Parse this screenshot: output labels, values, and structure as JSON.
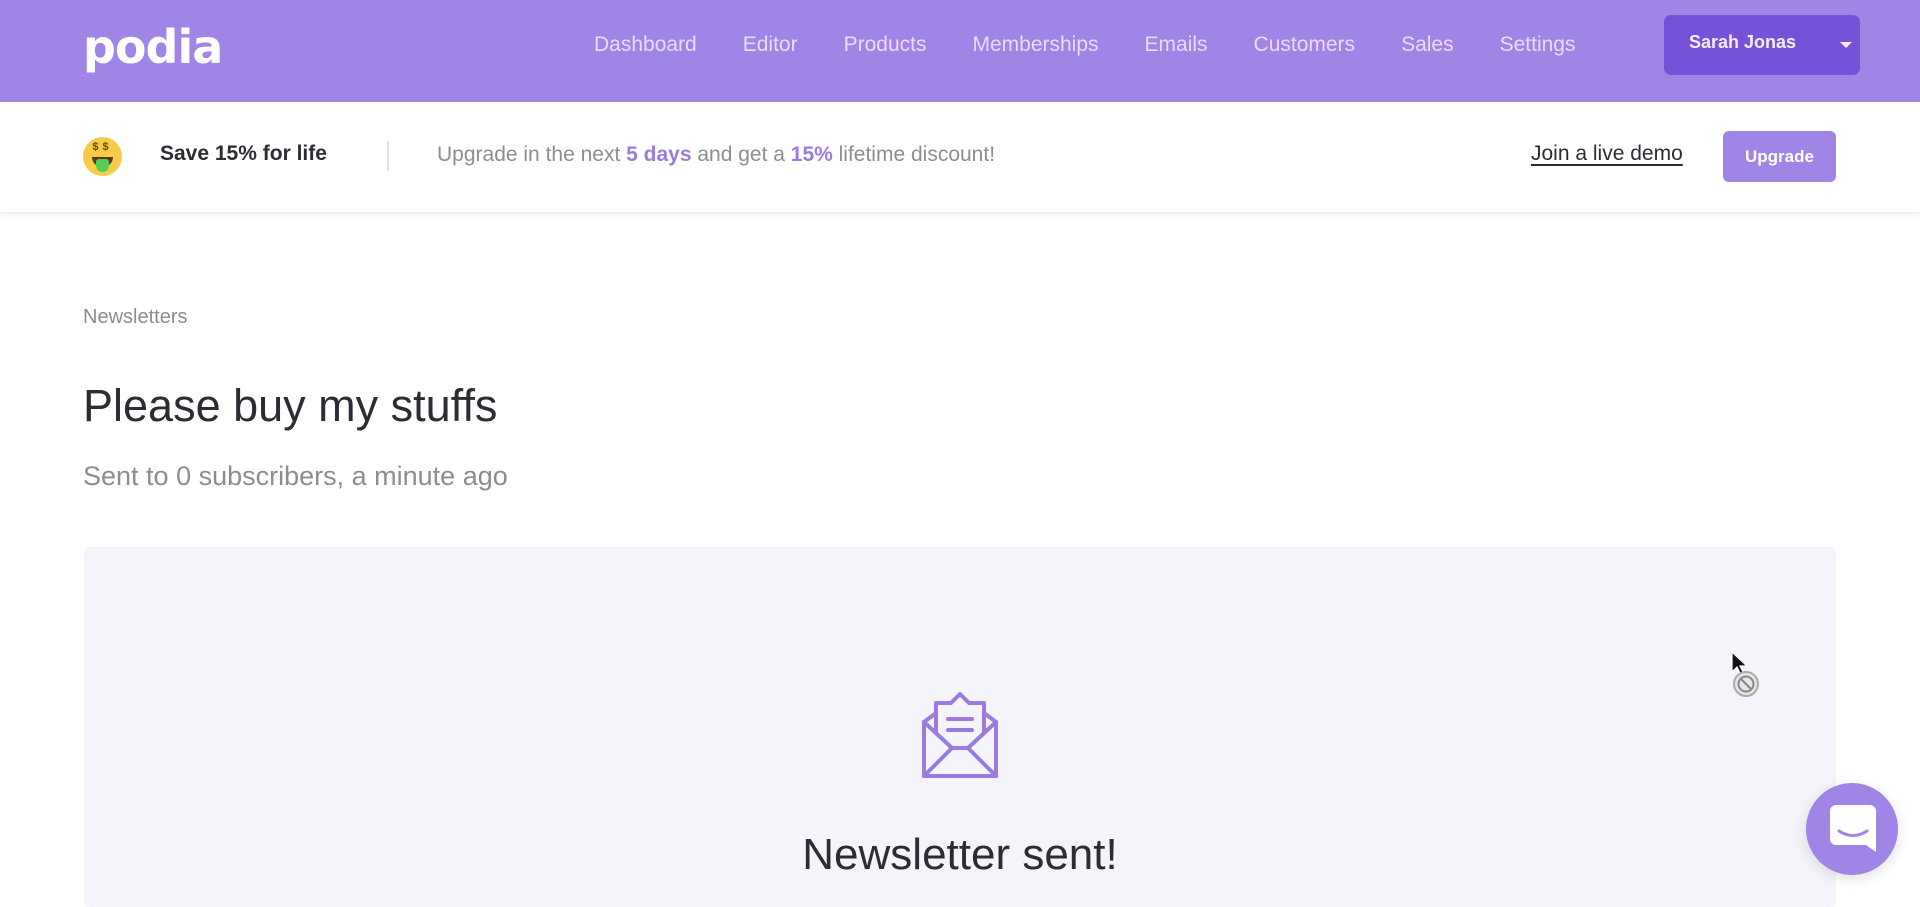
{
  "brand": {
    "logo_text": "podia",
    "accent_color": "#a084e6",
    "accent_dark": "#7652d8"
  },
  "nav": {
    "items": [
      {
        "label": "Dashboard"
      },
      {
        "label": "Editor"
      },
      {
        "label": "Products"
      },
      {
        "label": "Memberships"
      },
      {
        "label": "Emails"
      },
      {
        "label": "Customers"
      },
      {
        "label": "Sales"
      },
      {
        "label": "Settings"
      }
    ],
    "user": {
      "name": "Sarah Jonas",
      "icon": "caret-down-icon"
    }
  },
  "promo": {
    "emoji": "money-mouth-face-icon",
    "title": "Save 15% for life",
    "text_1": "Upgrade in the next ",
    "highlight_days": "5 days",
    "text_2": " and get a ",
    "highlight_discount": "15%",
    "text_3": " lifetime discount!",
    "demo_link": "Join a live demo",
    "upgrade_button": "Upgrade"
  },
  "page": {
    "breadcrumb": "Newsletters",
    "title": "Please buy my stuffs",
    "subtitle": "Sent to 0 subscribers, a minute ago"
  },
  "status_card": {
    "icon": "open-envelope-icon",
    "title": "Newsletter sent!"
  },
  "chat_widget": {
    "icon": "chat-bubble-icon"
  }
}
